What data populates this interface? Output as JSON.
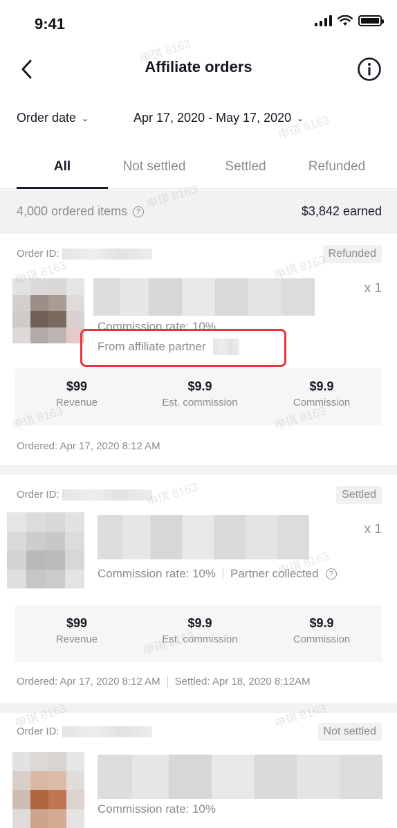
{
  "status_bar": {
    "time": "9:41"
  },
  "nav": {
    "title": "Affiliate orders"
  },
  "filters": {
    "order_date_label": "Order date",
    "date_range": "Apr 17, 2020 - May 17, 2020"
  },
  "tabs": [
    {
      "label": "All",
      "active": true
    },
    {
      "label": "Not settled",
      "active": false
    },
    {
      "label": "Settled",
      "active": false
    },
    {
      "label": "Refunded",
      "active": false
    }
  ],
  "summary": {
    "ordered_items": "4,000 ordered items",
    "earned": "$3,842 earned"
  },
  "orders": [
    {
      "order_id_label": "Order ID:",
      "status": "Refunded",
      "quantity": "x 1",
      "commission_rate": "Commission rate: 10%",
      "from_partner": "From affiliate partner",
      "stats": [
        {
          "value": "$99",
          "label": "Revenue"
        },
        {
          "value": "$9.9",
          "label": "Est. commission"
        },
        {
          "value": "$9.9",
          "label": "Commission"
        }
      ],
      "ordered": "Ordered: Apr 17, 2020 8:12 AM"
    },
    {
      "order_id_label": "Order ID:",
      "status": "Settled",
      "quantity": "x 1",
      "commission_rate": "Commission rate: 10%",
      "partner_collected": "Partner collected",
      "stats": [
        {
          "value": "$99",
          "label": "Revenue"
        },
        {
          "value": "$9.9",
          "label": "Est. commission"
        },
        {
          "value": "$9.9",
          "label": "Commission"
        }
      ],
      "ordered": "Ordered: Apr 17, 2020 8:12 AM",
      "settled": "Settled: Apr 18, 2020 8:12AM"
    },
    {
      "order_id_label": "Order ID:",
      "status": "Not settled",
      "commission_rate": "Commission rate: 10%"
    }
  ],
  "watermark_text": "申琪 8163",
  "colors": {
    "highlight": "#e4363d",
    "text_primary": "#161823",
    "text_secondary": "#8a8b91"
  }
}
